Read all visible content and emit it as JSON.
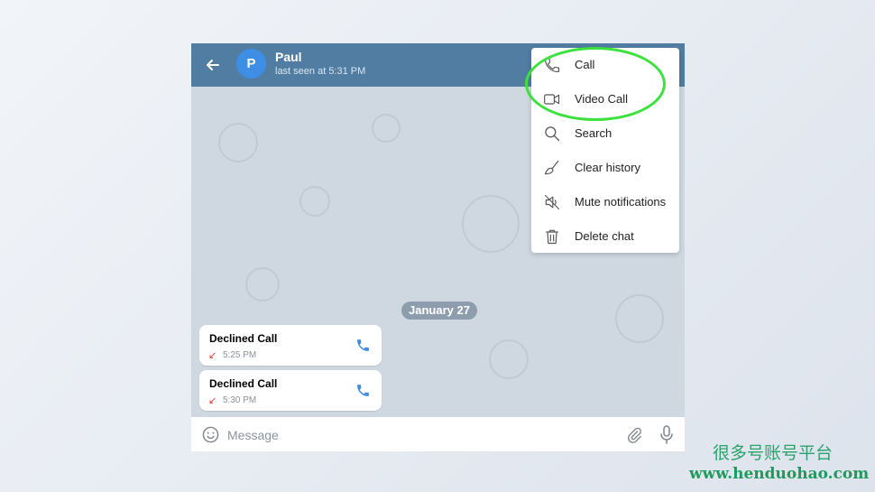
{
  "header": {
    "contact_name": "Paul",
    "avatar_letter": "P",
    "status": "last seen at 5:31 PM"
  },
  "chat": {
    "date_pill": "January 27",
    "messages": [
      {
        "title": "Declined Call",
        "time": "5:25 PM"
      },
      {
        "title": "Declined Call",
        "time": "5:30 PM"
      }
    ]
  },
  "input": {
    "placeholder": "Message"
  },
  "menu": {
    "items": [
      {
        "label": "Call",
        "icon": "phone-icon"
      },
      {
        "label": "Video Call",
        "icon": "video-camera-icon"
      },
      {
        "label": "Search",
        "icon": "search-icon"
      },
      {
        "label": "Clear history",
        "icon": "broom-icon"
      },
      {
        "label": "Mute notifications",
        "icon": "muted-speaker-icon"
      },
      {
        "label": "Delete chat",
        "icon": "trash-icon"
      }
    ]
  },
  "watermark": {
    "chinese": "很多号账号平台",
    "url": "www.henduohao.com"
  },
  "colors": {
    "header": "#517da2",
    "avatar": "#3e8ee6",
    "highlight_ellipse": "#3be23b",
    "declined_arrow": "#e53935",
    "call_icon": "#3a8de0"
  }
}
